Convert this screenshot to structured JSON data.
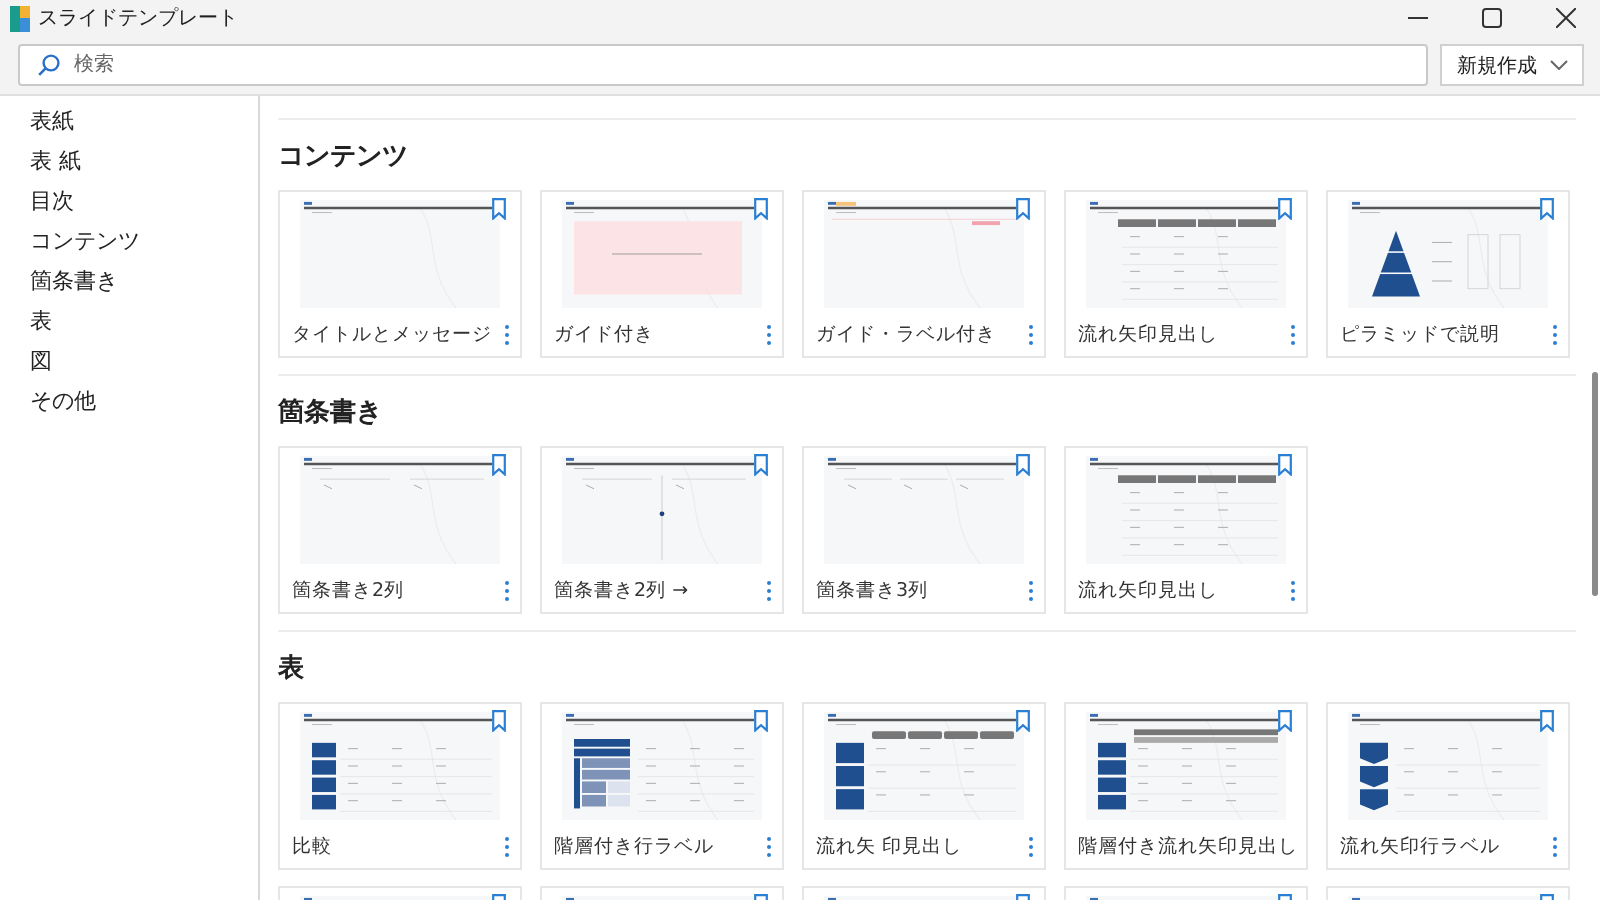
{
  "window": {
    "title": "スライドテンプレート"
  },
  "search": {
    "placeholder": "検索"
  },
  "new_button": {
    "label": "新規作成"
  },
  "sidebar": {
    "items": [
      {
        "label": "表紙"
      },
      {
        "label": "表 紙"
      },
      {
        "label": "目次"
      },
      {
        "label": "コンテンツ"
      },
      {
        "label": "箇条書き"
      },
      {
        "label": "表"
      },
      {
        "label": "図"
      },
      {
        "label": "その他"
      }
    ]
  },
  "sections": [
    {
      "title": "コンテンツ",
      "cards": [
        {
          "label": "タイトルとメッセージ",
          "kind": "plain"
        },
        {
          "label": "ガイド付き",
          "kind": "guide"
        },
        {
          "label": "ガイド・ラベル付き",
          "kind": "guide-label"
        },
        {
          "label": "流れ矢印見出し",
          "kind": "flow"
        },
        {
          "label": "ピラミッドで説明",
          "kind": "pyramid"
        }
      ]
    },
    {
      "title": "箇条書き",
      "cards": [
        {
          "label": "箇条書き2列",
          "kind": "columns2"
        },
        {
          "label": "箇条書き2列 →",
          "kind": "columns2-divider"
        },
        {
          "label": "箇条書き3列",
          "kind": "columns3"
        },
        {
          "label": "流れ矢印見出し",
          "kind": "flow"
        }
      ]
    },
    {
      "title": "表",
      "cards": [
        {
          "label": "比較",
          "kind": "row-boxes"
        },
        {
          "label": "階層付き行ラベル",
          "kind": "row-hier"
        },
        {
          "label": "流れ矢 印見出し",
          "kind": "row-flow"
        },
        {
          "label": "階層付き流れ矢印見出し",
          "kind": "row-hier-flow"
        },
        {
          "label": "流れ矢印行ラベル",
          "kind": "row-chevrons"
        },
        {
          "kind": "plain"
        },
        {
          "kind": "plain"
        },
        {
          "kind": "plain"
        },
        {
          "kind": "plain"
        },
        {
          "kind": "plain"
        }
      ]
    }
  ]
}
